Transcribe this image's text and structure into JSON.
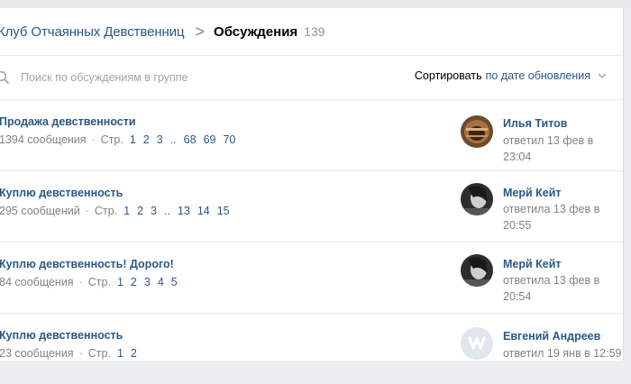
{
  "breadcrumb": {
    "group_name": "Клуб Отчаянных Девственниц",
    "separator": ">",
    "section": "Обсуждения",
    "count": "139"
  },
  "search": {
    "placeholder": "Поиск по обсуждениям в группе",
    "icon": "search-icon"
  },
  "sort": {
    "label": "Сортировать",
    "value": "по дате обновления",
    "icon": "chevron-down-icon"
  },
  "topics": [
    {
      "title": "Продажа девственности",
      "messages": "1394 сообщения",
      "pages_label": "Стр.",
      "pages": [
        "1",
        "2",
        "3",
        "..",
        "68",
        "69",
        "70"
      ],
      "author": "Илья Титов",
      "reply": "ответил 13 фев в 23:04"
    },
    {
      "title": "Куплю девственность",
      "messages": "295 сообщений",
      "pages_label": "Стр.",
      "pages": [
        "1",
        "2",
        "3",
        "..",
        "13",
        "14",
        "15"
      ],
      "author": "Мерй Кейт",
      "reply": "ответила 13 фев в 20:55"
    },
    {
      "title": "Куплю девственность! Дорого!",
      "messages": "84 сообщения",
      "pages_label": "Стр.",
      "pages": [
        "1",
        "2",
        "3",
        "4",
        "5"
      ],
      "author": "Мерй Кейт",
      "reply": "ответила 13 фев в 20:54"
    },
    {
      "title": "Куплю девственность",
      "messages": "23 сообщения",
      "pages_label": "Стр.",
      "pages": [
        "1",
        "2"
      ],
      "author": "Евгений Андреев",
      "reply": "ответил 19 янв в 12:59"
    }
  ],
  "colors": {
    "link": "#2a5885",
    "muted": "#828282",
    "background": "#edeef0"
  }
}
